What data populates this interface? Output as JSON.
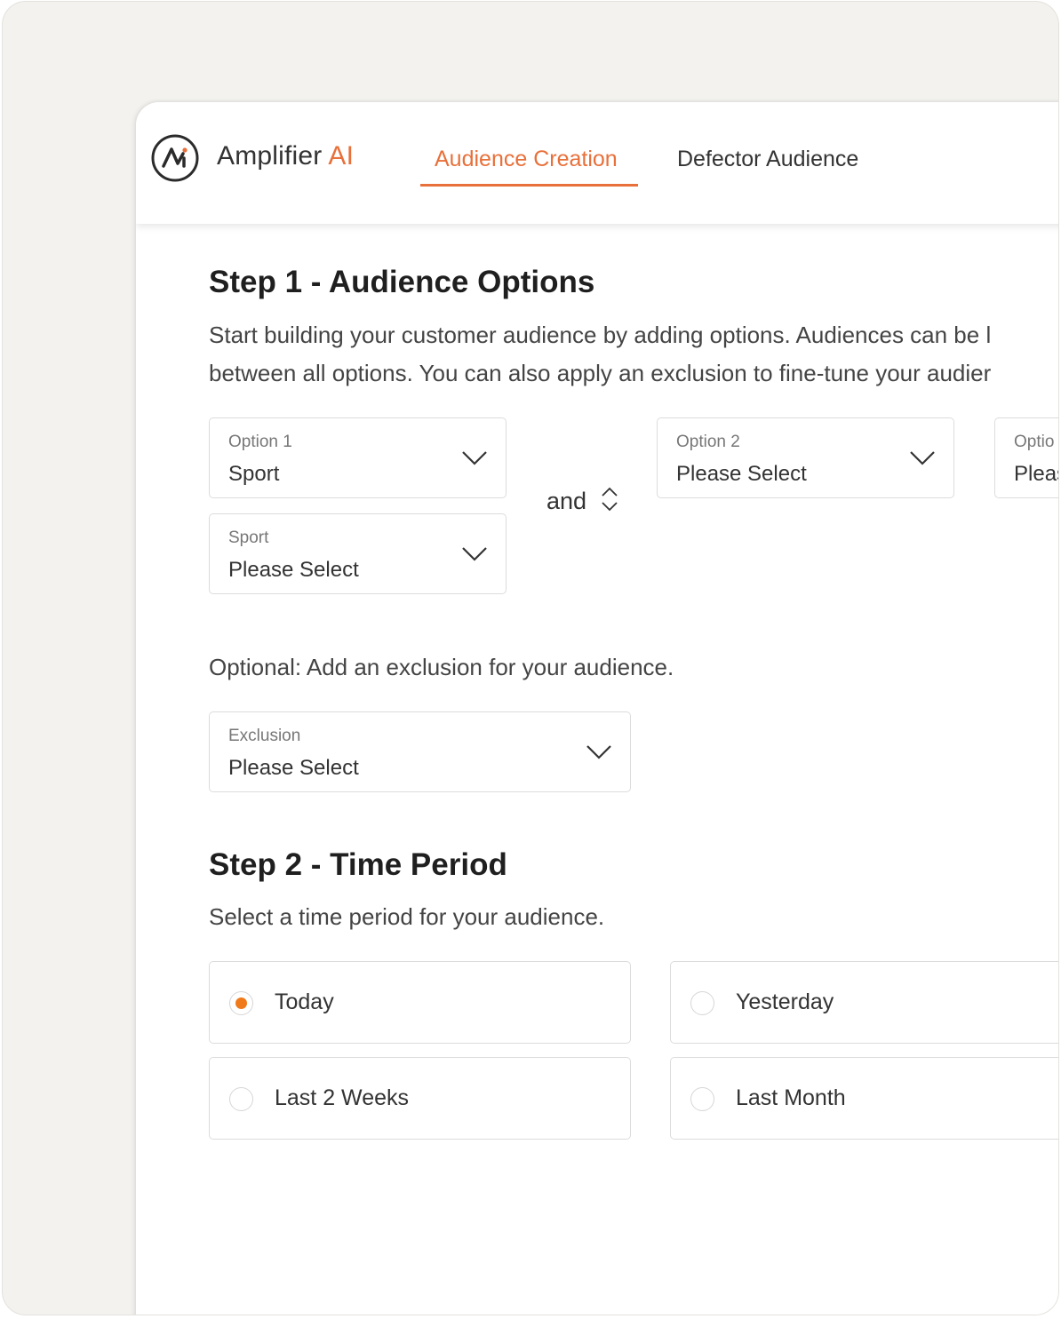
{
  "app": {
    "logo_name": "Amplifier",
    "logo_suffix": "AI",
    "accent_color": "#e8703a",
    "tabs": [
      {
        "label": "Audience Creation",
        "active": true
      },
      {
        "label": "Defector Audience",
        "active": false
      }
    ]
  },
  "step1": {
    "title": "Step 1 - Audience Options",
    "desc_line1": "Start building your customer audience by adding options. Audiences can be l",
    "desc_line2": "between all options. You can also apply an exclusion to fine-tune your audier",
    "option1": {
      "label": "Option 1",
      "value": "Sport"
    },
    "option1_sub": {
      "label": "Sport",
      "value": "Please Select"
    },
    "operator": "and",
    "option2": {
      "label": "Option 2",
      "value": "Please Select"
    },
    "option3": {
      "label": "Optio",
      "value": "Pleas"
    },
    "exclusion_prompt": "Optional: Add an exclusion for your audience.",
    "exclusion": {
      "label": "Exclusion",
      "value": "Please Select"
    }
  },
  "step2": {
    "title": "Step 2 - Time Period",
    "desc": "Select a time period for your audience.",
    "options": [
      {
        "label": "Today",
        "selected": true
      },
      {
        "label": "Yesterday",
        "selected": false
      },
      {
        "label": "Last 2 Weeks",
        "selected": false
      },
      {
        "label": "Last Month",
        "selected": false
      }
    ]
  }
}
